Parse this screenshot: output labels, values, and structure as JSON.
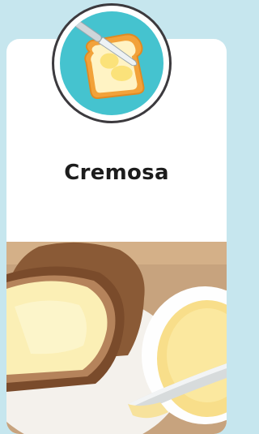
{
  "product": {
    "title": "Cremosa",
    "badge_icon": "butter-toast-knife-icon",
    "photo": "bread-with-butter-photo"
  },
  "colors": {
    "background": "#c6e6ee",
    "card": "#ffffff",
    "badge_fill": "#45c3cf",
    "badge_ring": "#3c3a3e",
    "toast_crust": "#f2a23a",
    "butter": "#fbe79a"
  }
}
